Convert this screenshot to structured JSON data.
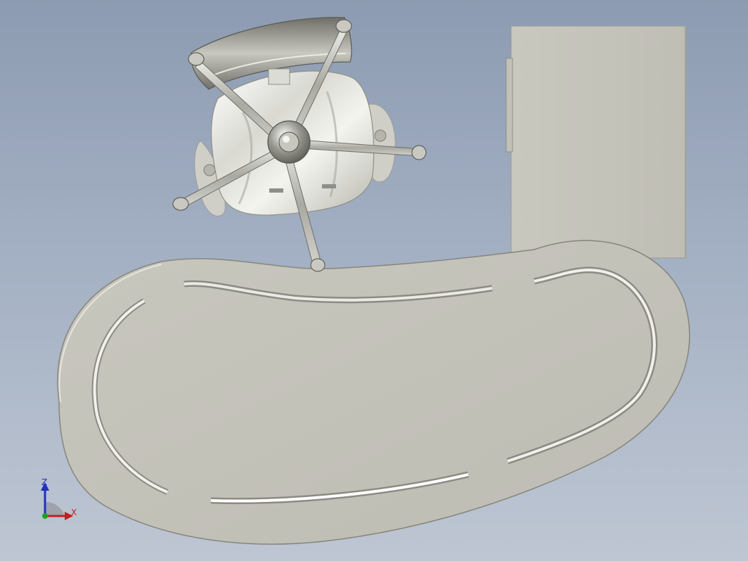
{
  "viewport": {
    "background_top": "#8d9bb2",
    "background_bottom": "#bec6d3"
  },
  "model": {
    "components": [
      "file-cabinet-icon",
      "desk-surface-icon",
      "office-chair-icon"
    ],
    "surface_color": "#c5c4bb",
    "chrome_color": "#d6d6d0"
  },
  "triad": {
    "z_label": "Z",
    "x_label": "X",
    "z_color": "#2030c0",
    "x_color": "#c02020",
    "y_color": "#20a020"
  }
}
